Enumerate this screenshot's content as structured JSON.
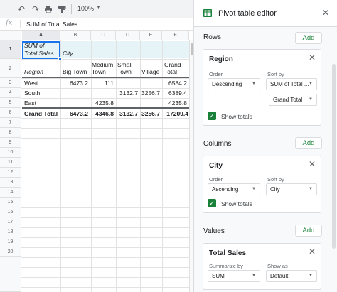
{
  "toolbar": {
    "undo_icon": "undo-icon",
    "redo_icon": "redo-icon",
    "print_icon": "print-icon",
    "paint_format_icon": "paint-format-icon",
    "zoom": "100%"
  },
  "formula_bar": {
    "fx": "fx",
    "value": "SUM of Total Sales"
  },
  "columns": [
    "A",
    "B",
    "C",
    "D",
    "E",
    "F"
  ],
  "rows": [
    "1",
    "2",
    "3",
    "4",
    "5",
    "6",
    "7",
    "8",
    "9",
    "10",
    "11",
    "12",
    "13",
    "14",
    "15",
    "16",
    "17",
    "18",
    "19",
    "20"
  ],
  "pivot": {
    "corner_line1": "SUM of",
    "corner_line2": "Total Sales",
    "columns_label": "City",
    "row_header": "Region",
    "col_headers": [
      {
        "line1": "",
        "line2": "Big Town"
      },
      {
        "line1": "Medium",
        "line2": "Town"
      },
      {
        "line1": "Small",
        "line2": "Town"
      },
      {
        "line1": "",
        "line2": "Village"
      },
      {
        "line1": "Grand",
        "line2": "Total"
      }
    ],
    "data_rows": [
      {
        "label": "West",
        "values": [
          "6473.2",
          "111",
          "",
          "",
          "6584.2"
        ]
      },
      {
        "label": "South",
        "values": [
          "",
          "",
          "3132.7",
          "3256.7",
          "6389.4"
        ]
      },
      {
        "label": "East",
        "values": [
          "",
          "4235.8",
          "",
          "",
          "4235.8"
        ]
      }
    ],
    "total_row": {
      "label": "Grand Total",
      "values": [
        "6473.2",
        "4346.8",
        "3132.7",
        "3256.7",
        "17209.4"
      ]
    }
  },
  "editor": {
    "title": "Pivot table editor",
    "close_icon": "close-icon",
    "rows_section": {
      "label": "Rows",
      "add_label": "Add",
      "card": {
        "title": "Region",
        "order_label": "Order",
        "order_value": "Descending",
        "sort_label": "Sort by",
        "sort_value": "SUM of Total ...",
        "sort_sub_value": "Grand Total",
        "show_totals": "Show totals"
      }
    },
    "columns_section": {
      "label": "Columns",
      "add_label": "Add",
      "card": {
        "title": "City",
        "order_label": "Order",
        "order_value": "Ascending",
        "sort_label": "Sort by",
        "sort_value": "City",
        "show_totals": "Show totals"
      }
    },
    "values_section": {
      "label": "Values",
      "add_label": "Add",
      "card": {
        "title": "Total Sales",
        "summarize_label": "Summarize by",
        "summarize_value": "SUM",
        "show_as_label": "Show as",
        "show_as_value": "Default"
      }
    }
  },
  "colors": {
    "accent_green": "#188038",
    "selection_blue": "#1a73e8",
    "pivot_header_bg": "#e6f4f8"
  }
}
